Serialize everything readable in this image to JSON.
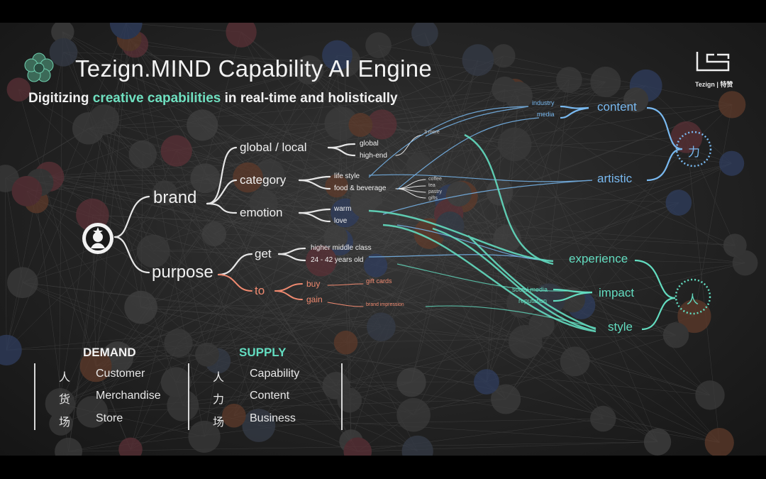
{
  "header": {
    "title": "Tezign.MIND Capability AI Engine",
    "subtitle_pre": "Digitizing ",
    "subtitle_highlight": "creative capabilities",
    "subtitle_post": " in real-time and holistically",
    "brand_logo_text": "Tezign | 特赞"
  },
  "tree": {
    "brand": "brand",
    "purpose": "purpose",
    "global_local": "global / local",
    "category": "category",
    "emotion": "emotion",
    "get": "get",
    "to": "to",
    "global": "global",
    "high_end": "high-end",
    "more": "3 more",
    "life_style": "life style",
    "food_beverage": "food & beverage",
    "coffee": "coffee",
    "tea": "tea",
    "pastry": "pastry",
    "gifts": "gifts",
    "warm": "warm",
    "love": "love",
    "higher_middle": "higher middle class",
    "age": "24 - 42 years old",
    "buy": "buy",
    "gain": "gain",
    "gift_cards": "gift cards",
    "brand_impression": "brand impression"
  },
  "right": {
    "industry": "industry",
    "media": "media",
    "content": "content",
    "artistic": "artistic",
    "li_glyph": "力",
    "experience": "experience",
    "social_media": "social media",
    "reputation": "reputation",
    "impact": "impact",
    "style": "style",
    "ren_glyph": "人"
  },
  "legend": {
    "demand_title": "DEMAND",
    "supply_title": "SUPPLY",
    "demand": [
      {
        "glyph": "人",
        "label": "Customer"
      },
      {
        "glyph": "货",
        "label": "Merchandise"
      },
      {
        "glyph": "场",
        "label": "Store"
      }
    ],
    "supply": [
      {
        "glyph": "人",
        "label": "Capability"
      },
      {
        "glyph": "力",
        "label": "Content"
      },
      {
        "glyph": "场",
        "label": "Business"
      }
    ]
  },
  "colors": {
    "blue": "#79b9f0",
    "teal": "#63dcc0",
    "orange": "#f08a70"
  }
}
